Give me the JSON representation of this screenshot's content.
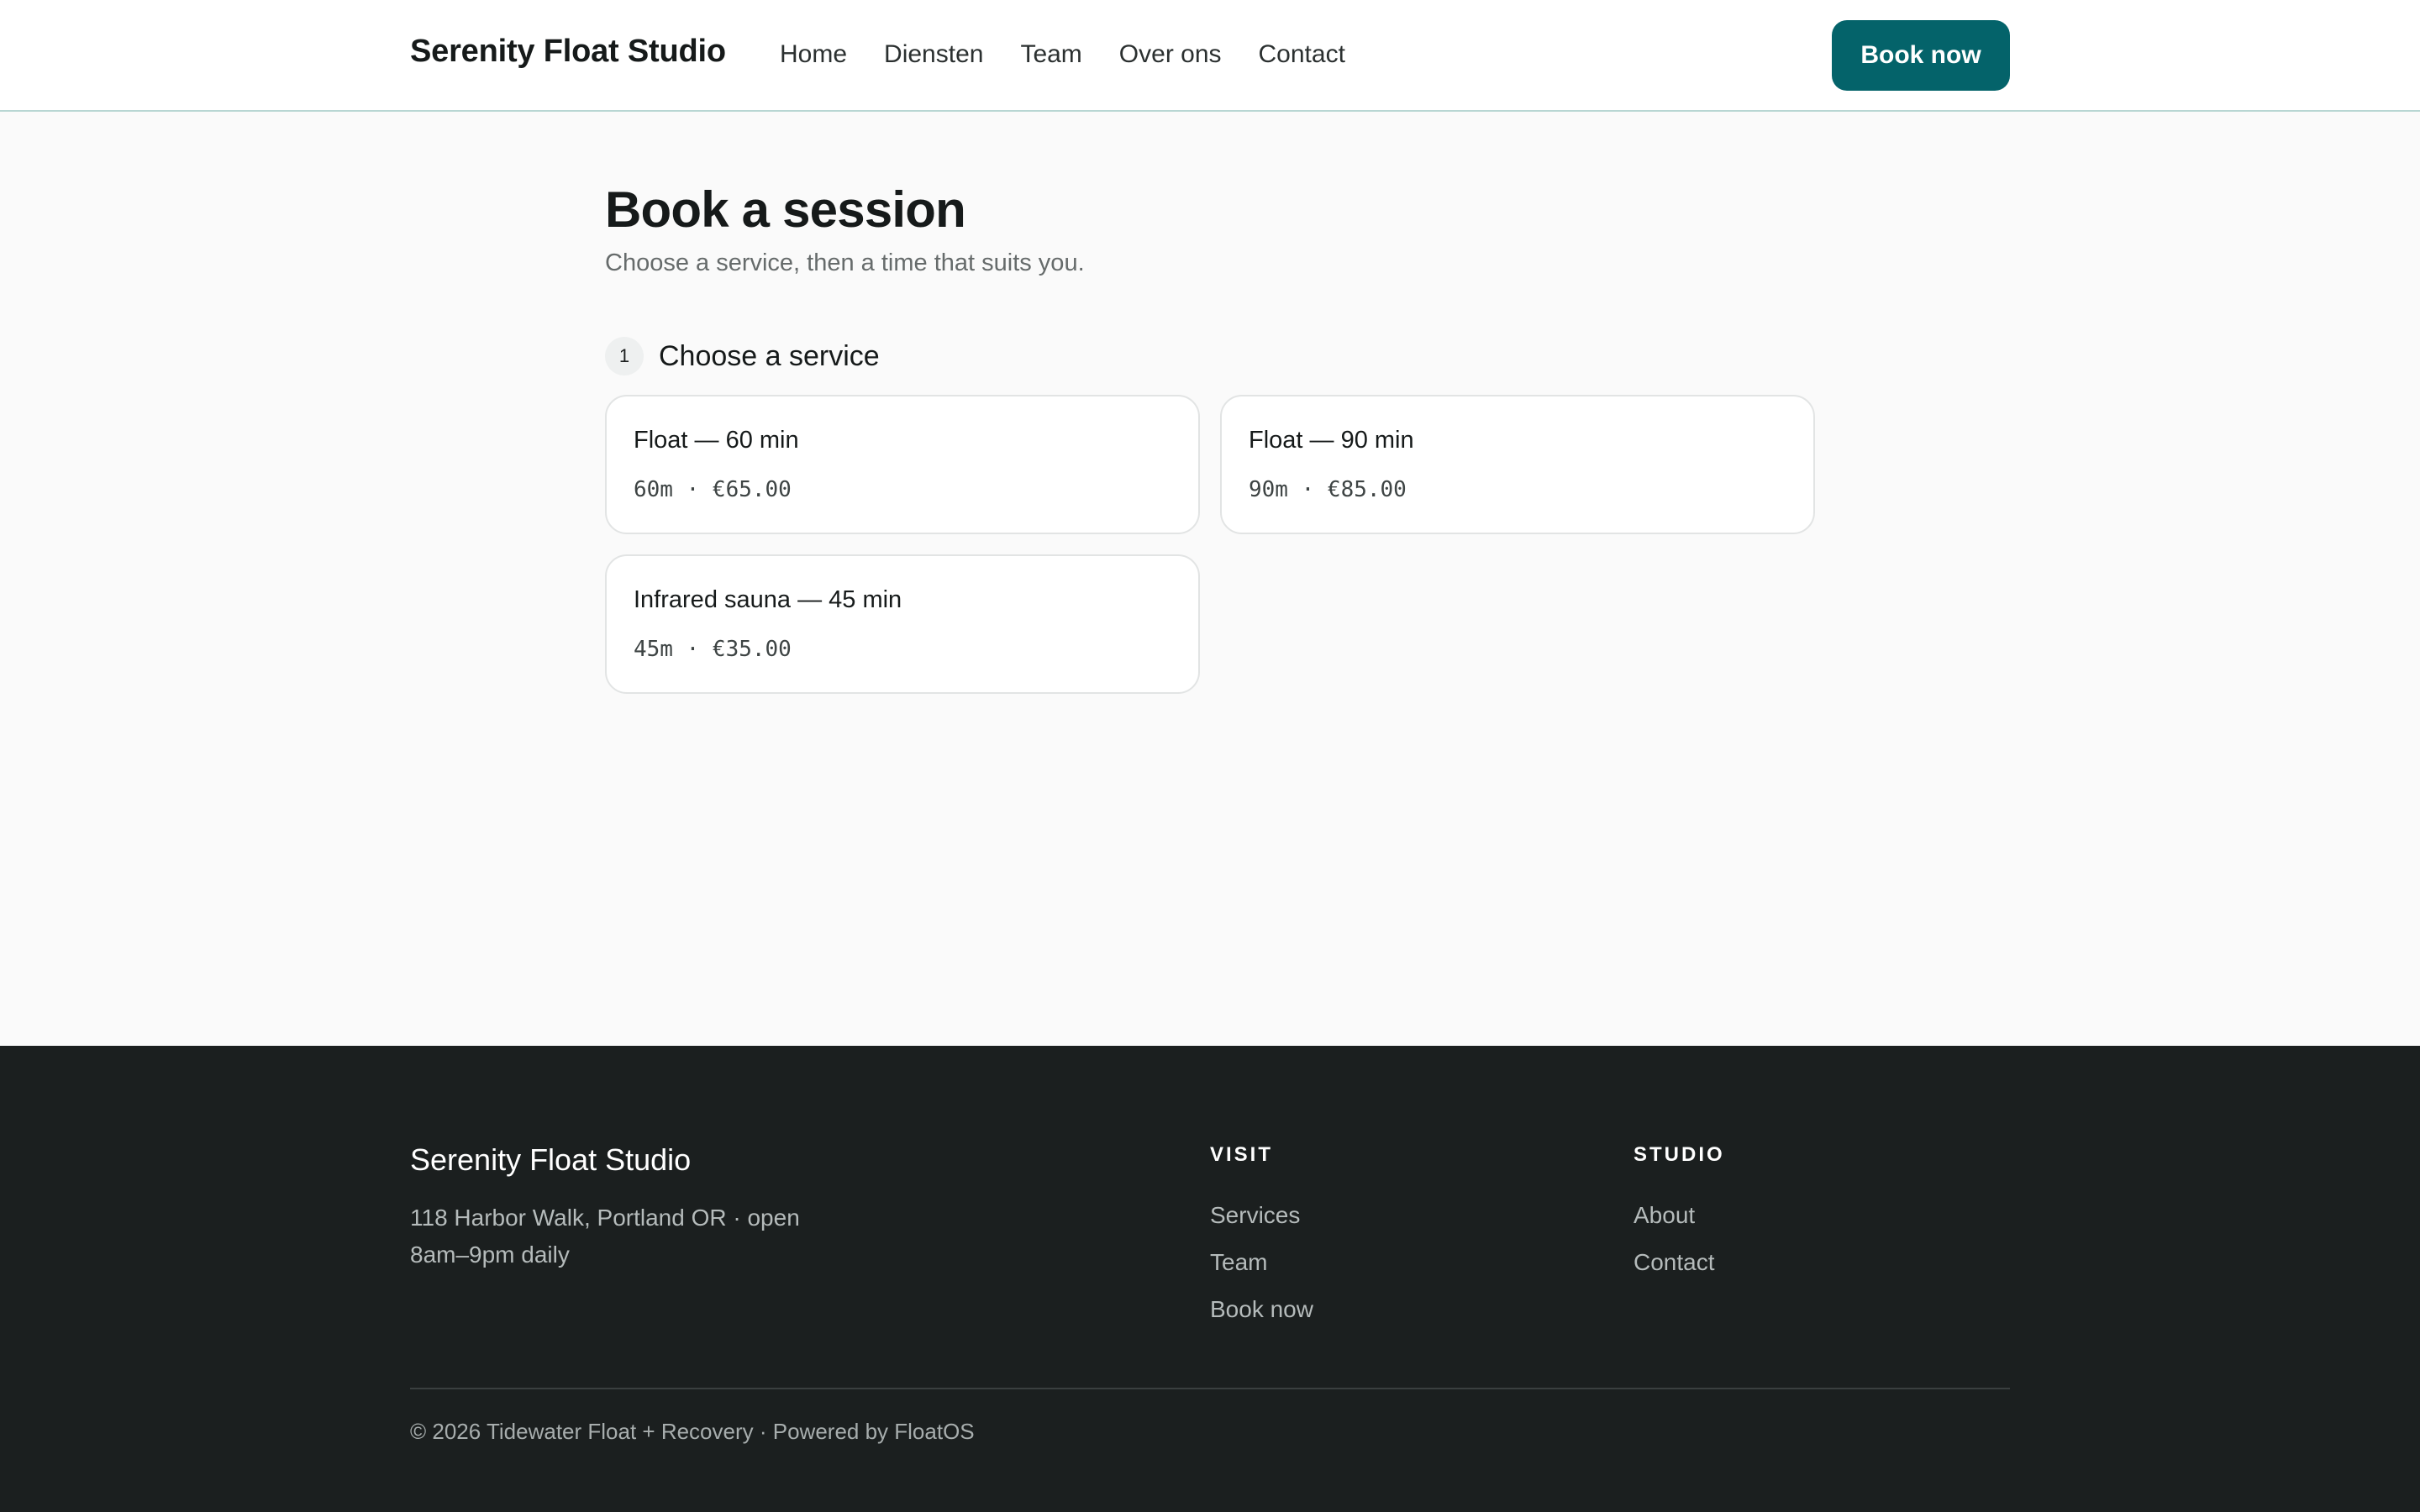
{
  "header": {
    "brand": "Serenity Float Studio",
    "nav": [
      {
        "label": "Home"
      },
      {
        "label": "Diensten"
      },
      {
        "label": "Team"
      },
      {
        "label": "Over ons"
      },
      {
        "label": "Contact"
      }
    ],
    "cta_label": "Book now"
  },
  "main": {
    "title": "Book a session",
    "subtitle": "Choose a service, then a time that suits you.",
    "step": {
      "number": "1",
      "label": "Choose a service"
    },
    "services": [
      {
        "name": "Float — 60 min",
        "meta": "60m · €65.00"
      },
      {
        "name": "Float — 90 min",
        "meta": "90m · €85.00"
      },
      {
        "name": "Infrared sauna — 45 min",
        "meta": "45m · €35.00"
      }
    ]
  },
  "footer": {
    "brand": "Serenity Float Studio",
    "address": "118 Harbor Walk, Portland OR · open 8am–9pm daily",
    "visit": {
      "heading": "VISIT",
      "links": [
        "Services",
        "Team",
        "Book now"
      ]
    },
    "studio": {
      "heading": "STUDIO",
      "links": [
        "About",
        "Contact"
      ]
    },
    "copyright": "© 2026 Tidewater Float + Recovery · Powered by FloatOS"
  },
  "colors": {
    "accent": "#04636a",
    "footer_bg": "#1b1f1f",
    "page_bg": "#fafafa"
  }
}
